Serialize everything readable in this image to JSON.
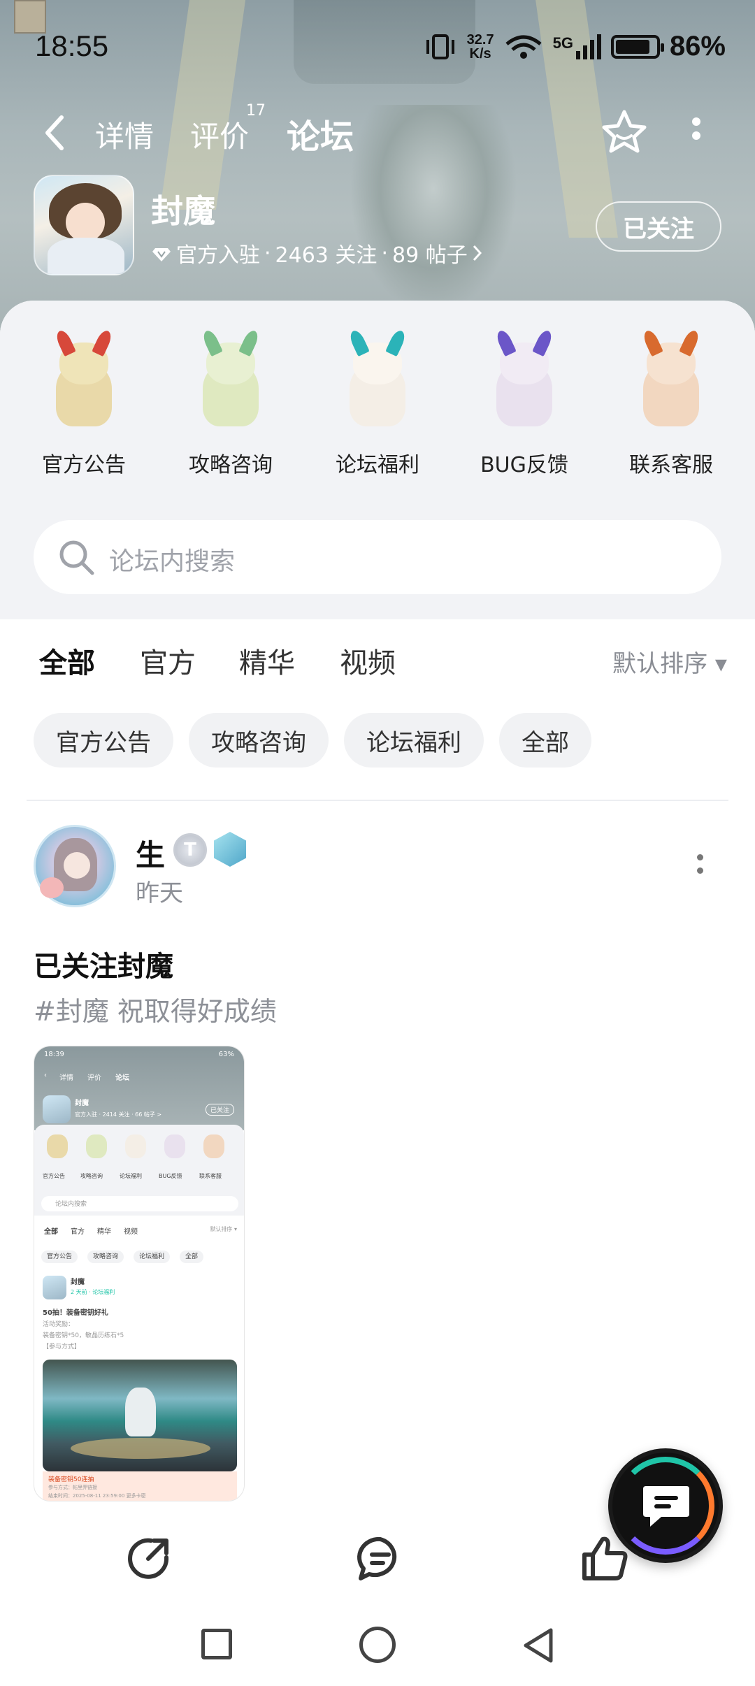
{
  "status_bar": {
    "time": "18:55",
    "net_speed_value": "32.7",
    "net_speed_unit": "K/s",
    "signal": "5G",
    "battery_percent": "86%",
    "battery_level": 0.86
  },
  "nav": {
    "back_icon": "back-chevron-icon",
    "tabs": [
      {
        "label": "详情"
      },
      {
        "label": "评价",
        "count": "17"
      },
      {
        "label": "论坛",
        "active": true
      }
    ],
    "favorite_icon": "star-outline-icon",
    "more_icon": "vertical-dots-icon"
  },
  "game": {
    "name": "封魔",
    "official_label": "官方入驻",
    "followers": "2463 关注",
    "posts": "89 帖子",
    "separator": "·",
    "follow_button": "已关注"
  },
  "categories": [
    {
      "label": "官方公告",
      "color": "#e9d9a9",
      "accent": "#d7483a"
    },
    {
      "label": "攻略咨询",
      "color": "#dfe9c0",
      "accent": "#7bbf8a"
    },
    {
      "label": "论坛福利",
      "color": "#f4eee6",
      "accent": "#2bb3b8"
    },
    {
      "label": "BUG反馈",
      "color": "#e9e1ee",
      "accent": "#6b56c8"
    },
    {
      "label": "联系客服",
      "color": "#f2d7c0",
      "accent": "#d86a2e"
    }
  ],
  "search": {
    "placeholder": "论坛内搜索"
  },
  "filter_tabs": [
    {
      "label": "全部",
      "active": true
    },
    {
      "label": "官方"
    },
    {
      "label": "精华"
    },
    {
      "label": "视频"
    }
  ],
  "sort": {
    "label": "默认排序 ▾"
  },
  "chips": [
    "官方公告",
    "攻略咨询",
    "论坛福利",
    "全部"
  ],
  "post": {
    "author": "生",
    "level_badge": "T",
    "time": "昨天",
    "title": "已关注封魔",
    "body": "#封魔 祝取得好成绩",
    "thumbnail": {
      "time": "18:39",
      "battery": "63%",
      "tabs": [
        "详情",
        "评价",
        "论坛"
      ],
      "name": "封魔",
      "meta": "官方入驻 · 2414 关注 · 66 帖子 >",
      "follow": "已关注",
      "cats": [
        "官方公告",
        "攻略咨询",
        "论坛福利",
        "BUG反馈",
        "联系客服"
      ],
      "search": "论坛内搜索",
      "ftabs": [
        "全部",
        "官方",
        "精华",
        "视频"
      ],
      "sort": "默认排序 ▾",
      "chips": [
        "官方公告",
        "攻略咨询",
        "论坛福利",
        "全部"
      ],
      "post_author": "封魔",
      "post_meta": "2 天前 · 论坛福利",
      "post_title": "50抽！装备密钥好礼",
      "post_line1": "活动奖励：",
      "post_line2": "装备密钥*50，敏晶历练石*5",
      "post_line3": "【参与方式】",
      "footer_tag": "装备密钥50连抽",
      "footer_line1": "参与方式：帖里弄链接",
      "footer_line2": "结束时间：2025-08-11 23:59:00 更多卡密"
    }
  },
  "floating_chat": {
    "icon": "chat-bubble-icon"
  },
  "actions": [
    {
      "icon": "share-icon"
    },
    {
      "icon": "comment-icon"
    },
    {
      "icon": "like-icon"
    }
  ],
  "system_nav": [
    "recent-apps-icon",
    "home-icon",
    "back-triangle-icon"
  ],
  "colors": {
    "accent": "#20c5a8",
    "text_gray": "#8d9097"
  }
}
